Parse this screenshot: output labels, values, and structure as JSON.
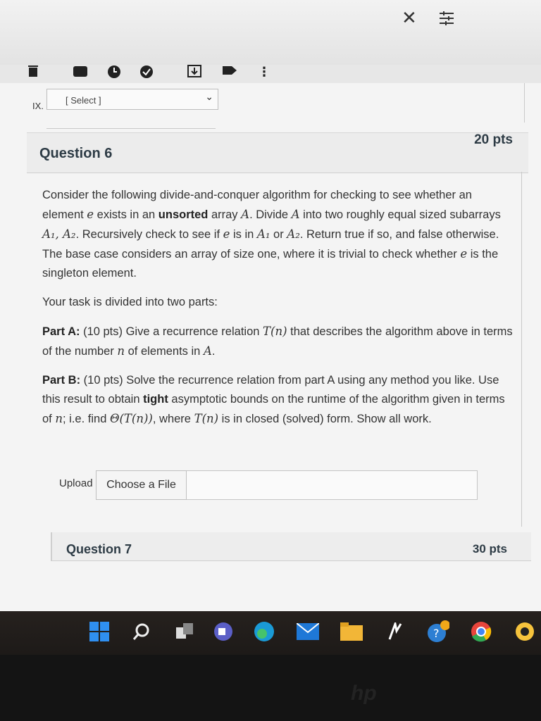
{
  "top": {
    "close_glyph": "✕",
    "settings_glyph": "⚙"
  },
  "toolbar": {
    "icons": [
      "trash-icon",
      "archive-icon",
      "clock-icon",
      "check-icon",
      "download-icon",
      "tag-icon",
      "more-icon"
    ]
  },
  "prev_item": {
    "number": "IX.",
    "select_value": "[ Select ]"
  },
  "question6": {
    "title": "Question 6",
    "points": "20 pts",
    "paragraph1_a": "Consider the following divide-and-conquer algorithm for checking to see whether an element ",
    "paragraph1_e": "e",
    "paragraph1_b": " exists in an ",
    "paragraph1_unsorted": "unsorted",
    "paragraph1_c": " array ",
    "paragraph1_A": "A",
    "paragraph1_d": ". Divide ",
    "paragraph1_f": " into two roughly equal sized subarrays ",
    "paragraph1_A1A2": "A₁, A₂",
    "paragraph1_g": ". Recursively check to see if ",
    "paragraph1_h": " is in ",
    "paragraph1_A1": "A₁",
    "paragraph1_or": " or ",
    "paragraph1_A2": "A₂",
    "paragraph1_i": ". Return true if so, and false otherwise. The base case considers an array of size one, where it is trivial to check whether ",
    "paragraph1_j": " is the singleton element.",
    "task_intro": "Your task is divided into two parts:",
    "partA_label": "Part A:",
    "partA_a": " (10 pts) Give a recurrence relation ",
    "partA_Tn": "T(n)",
    "partA_b": " that describes the algorithm above in terms of the number ",
    "partA_n": "n",
    "partA_c": " of elements in ",
    "partA_d": ".",
    "partB_label": "Part B:",
    "partB_a": " (10 pts) Solve the recurrence relation from part A using any method you like. Use this result to obtain ",
    "partB_tight": "tight",
    "partB_b": " asymptotic bounds on the runtime of the algorithm given in terms of ",
    "partB_n": "n",
    "partB_c": "; i.e. find ",
    "partB_theta": "Θ(T(n))",
    "partB_d": ", where ",
    "partB_Tn": "T(n)",
    "partB_e": " is in closed (solved) form. Show all work.",
    "upload_label": "Upload",
    "choose_file": "Choose a File"
  },
  "question7": {
    "title": "Question 7",
    "points": "30 pts"
  },
  "taskbar": {
    "icons": [
      "windows-start-icon",
      "search-icon",
      "task-view-icon",
      "teams-icon",
      "edge-icon",
      "mail-icon",
      "file-explorer-icon",
      "app-icon",
      "help-icon",
      "chrome-icon",
      "other-app-icon"
    ]
  },
  "colors": {
    "heading": "#2d3b45",
    "taskbar": "#211d1a",
    "page": "#f4f4f4"
  }
}
